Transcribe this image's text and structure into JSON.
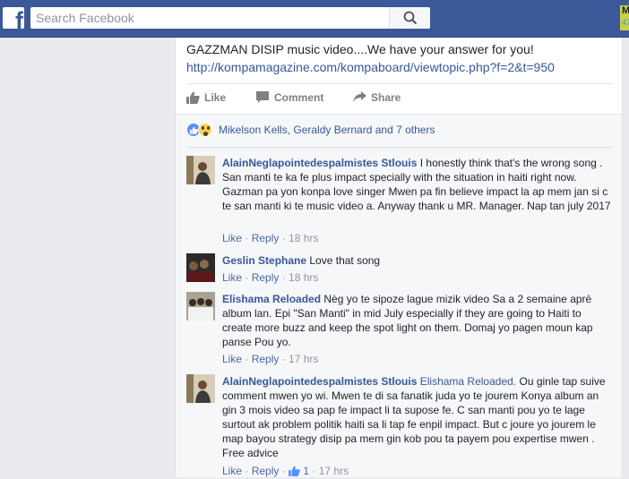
{
  "topbar": {
    "logo_letter": "f",
    "search_placeholder": "Search Facebook",
    "corner_badge_top": "M",
    "corner_badge_bottom": "47"
  },
  "post": {
    "text": "GAZZMAN DISIP music video....We have your answer for you!",
    "link": "http://kompamagazine.com/kompaboard/viewtopic.php?f=2&t=950",
    "actions": {
      "like": "Like",
      "comment": "Comment",
      "share": "Share"
    }
  },
  "reactions": {
    "names": "Mikelson Kells, Geraldy Bernard and 7 others"
  },
  "comments": [
    {
      "author": "AlainNeglapointedespalmistes Stlouis",
      "tag": "",
      "text": "I honestly think that's the wrong song . San manti te ka fe plus impact specially with the situation in haiti right now. Gazman pa yon konpa love singer Mwen pa fin believe impact la ap mem jan si c te san manti ki te music video a. Anyway thank u MR. Manager. Nap tan july 2017",
      "like": "Like",
      "reply": "Reply",
      "likes": "",
      "time": "18 hrs"
    },
    {
      "author": "Geslin Stephane",
      "tag": "",
      "text": "Love that song",
      "like": "Like",
      "reply": "Reply",
      "likes": "",
      "time": "18 hrs"
    },
    {
      "author": "Elishama Reloaded",
      "tag": "",
      "text": "Nèg yo te sipoze lague mizik video Sa a 2 semaine aprè album lan. Epi \"San Manti\" in mid July especially if they are going to Haiti to create more buzz and keep the spot light on them. Domaj yo pagen moun kap panse Pou yo.",
      "like": "Like",
      "reply": "Reply",
      "likes": "",
      "time": "17 hrs"
    },
    {
      "author": "AlainNeglapointedespalmistes Stlouis",
      "tag": "Elishama Reloaded.",
      "text": "Ou ginle tap suive comment mwen yo wi. Mwen te di sa fanatik juda yo te jourem Konya album an gin 3 mois video sa pap fe impact li ta supose fe. C san manti pou yo te lage surtout ak problem politik haiti sa li tap fe enpil impact. But c joure yo jourem le map bayou strategy disip pa mem gin kob pou ta payem pou expertise mwen . Free advice",
      "like": "Like",
      "reply": "Reply",
      "likes": "1",
      "time": "17 hrs"
    }
  ],
  "colors": {
    "brand": "#3b5998",
    "link": "#365899",
    "muted": "#90949c"
  }
}
